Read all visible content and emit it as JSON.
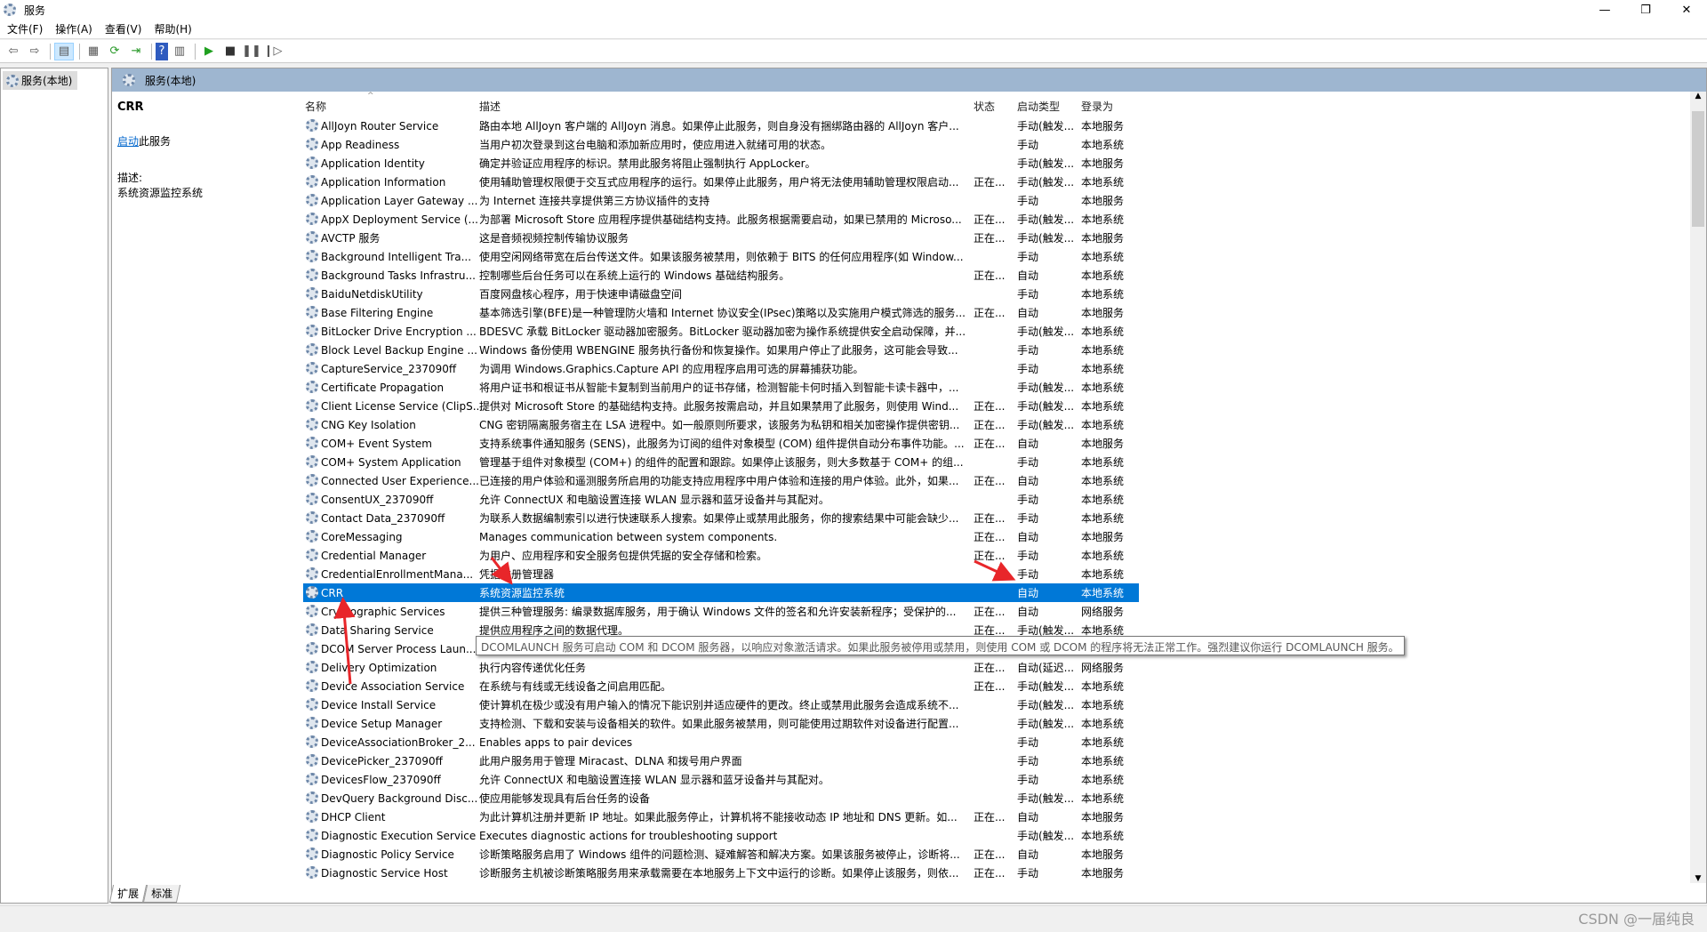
{
  "window": {
    "title": "服务",
    "minimize": "—",
    "restore": "❐",
    "close": "✕"
  },
  "menu": [
    "文件(F)",
    "操作(A)",
    "查看(V)",
    "帮助(H)"
  ],
  "toolbar": [
    "back-icon",
    "forward-icon",
    "show-hide-console-tree-icon",
    "properties-icon",
    "refresh-icon",
    "export-list-icon",
    "help-icon",
    "show-action-pane-icon",
    "start-service-icon",
    "stop-service-icon",
    "pause-service-icon",
    "resume-service-icon"
  ],
  "tree": {
    "root": "服务(本地)"
  },
  "main": {
    "header": "服务(本地)"
  },
  "extended": {
    "service_name": "CRR",
    "start_link": "启动",
    "start_suffix": "此服务",
    "desc_label": "描述:",
    "desc": "系统资源监控系统"
  },
  "columns": [
    "名称",
    "描述",
    "状态",
    "启动类型",
    "登录为"
  ],
  "selected_index": 25,
  "rows": [
    [
      "AllJoyn Router Service",
      "路由本地 AllJoyn 客户端的 AllJoyn 消息。如果停止此服务，则自身没有捆绑路由器的 AllJoyn 客户...",
      "",
      "手动(触发...",
      "本地服务"
    ],
    [
      "App Readiness",
      "当用户初次登录到这台电脑和添加新应用时，使应用进入就绪可用的状态。",
      "",
      "手动",
      "本地系统"
    ],
    [
      "Application Identity",
      "确定并验证应用程序的标识。禁用此服务将阻止强制执行 AppLocker。",
      "",
      "手动(触发...",
      "本地服务"
    ],
    [
      "Application Information",
      "使用辅助管理权限便于交互式应用程序的运行。如果停止此服务，用户将无法使用辅助管理权限启动...",
      "正在...",
      "手动(触发...",
      "本地系统"
    ],
    [
      "Application Layer Gateway ...",
      "为 Internet 连接共享提供第三方协议插件的支持",
      "",
      "手动",
      "本地服务"
    ],
    [
      "AppX Deployment Service (...",
      "为部署 Microsoft Store 应用程序提供基础结构支持。此服务根据需要启动，如果已禁用的 Microso...",
      "正在...",
      "手动(触发...",
      "本地系统"
    ],
    [
      "AVCTP 服务",
      "这是音频视频控制传输协议服务",
      "正在...",
      "手动(触发...",
      "本地服务"
    ],
    [
      "Background Intelligent Tra...",
      "使用空闲网络带宽在后台传送文件。如果该服务被禁用，则依赖于 BITS 的任何应用程序(如 Window...",
      "",
      "手动",
      "本地系统"
    ],
    [
      "Background Tasks Infrastru...",
      "控制哪些后台任务可以在系统上运行的 Windows 基础结构服务。",
      "正在...",
      "自动",
      "本地系统"
    ],
    [
      "BaiduNetdiskUtility",
      "百度网盘核心程序，用于快速申请磁盘空间",
      "",
      "手动",
      "本地系统"
    ],
    [
      "Base Filtering Engine",
      "基本筛选引擎(BFE)是一种管理防火墙和 Internet 协议安全(IPsec)策略以及实施用户模式筛选的服务...",
      "正在...",
      "自动",
      "本地服务"
    ],
    [
      "BitLocker Drive Encryption ...",
      "BDESVC 承载 BitLocker 驱动器加密服务。BitLocker 驱动器加密为操作系统提供安全启动保障，并...",
      "",
      "手动(触发...",
      "本地系统"
    ],
    [
      "Block Level Backup Engine ...",
      "Windows 备份使用 WBENGINE 服务执行备份和恢复操作。如果用户停止了此服务，这可能会导致...",
      "",
      "手动",
      "本地系统"
    ],
    [
      "CaptureService_237090ff",
      "为调用 Windows.Graphics.Capture API 的应用程序启用可选的屏幕捕获功能。",
      "",
      "手动",
      "本地系统"
    ],
    [
      "Certificate Propagation",
      "将用户证书和根证书从智能卡复制到当前用户的证书存储，检测智能卡何时插入到智能卡读卡器中，...",
      "",
      "手动(触发...",
      "本地系统"
    ],
    [
      "Client License Service (ClipS...",
      "提供对 Microsoft Store 的基础结构支持。此服务按需启动，并且如果禁用了此服务，则使用 Wind...",
      "正在...",
      "手动(触发...",
      "本地系统"
    ],
    [
      "CNG Key Isolation",
      "CNG 密钥隔离服务宿主在 LSA 进程中。如一般原则所要求，该服务为私钥和相关加密操作提供密钥...",
      "正在...",
      "手动(触发...",
      "本地系统"
    ],
    [
      "COM+ Event System",
      "支持系统事件通知服务 (SENS)，此服务为订阅的组件对象模型 (COM) 组件提供自动分布事件功能。...",
      "正在...",
      "自动",
      "本地服务"
    ],
    [
      "COM+ System Application",
      "管理基于组件对象模型 (COM+) 的组件的配置和跟踪。如果停止该服务，则大多数基于 COM+ 的组...",
      "",
      "手动",
      "本地系统"
    ],
    [
      "Connected User Experience...",
      "已连接的用户体验和遥测服务所启用的功能支持应用程序中用户体验和连接的用户体验。此外，如果...",
      "正在...",
      "自动",
      "本地系统"
    ],
    [
      "ConsentUX_237090ff",
      "允许 ConnectUX 和电脑设置连接 WLAN 显示器和蓝牙设备并与其配对。",
      "",
      "手动",
      "本地系统"
    ],
    [
      "Contact Data_237090ff",
      "为联系人数据编制索引以进行快速联系人搜索。如果停止或禁用此服务，你的搜索结果中可能会缺少...",
      "正在...",
      "手动",
      "本地系统"
    ],
    [
      "CoreMessaging",
      "Manages communication between system components.",
      "正在...",
      "自动",
      "本地服务"
    ],
    [
      "Credential Manager",
      "为用户、应用程序和安全服务包提供凭据的安全存储和检索。",
      "正在...",
      "手动",
      "本地系统"
    ],
    [
      "CredentialEnrollmentMana...",
      "凭据注册管理器",
      "",
      "手动",
      "本地系统"
    ],
    [
      "CRR",
      "系统资源监控系统",
      "",
      "自动",
      "本地系统"
    ],
    [
      "Cryptographic Services",
      "提供三种管理服务: 编录数据库服务，用于确认 Windows 文件的签名和允许安装新程序；受保护的...",
      "正在...",
      "自动",
      "网络服务"
    ],
    [
      "Data Sharing Service",
      "提供应用程序之间的数据代理。",
      "正在...",
      "手动(触发...",
      "本地系统"
    ],
    [
      "DCOM Server Process Laun...",
      "",
      "",
      "",
      ""
    ],
    [
      "Delivery Optimization",
      "执行内容传递优化任务",
      "正在...",
      "自动(延迟...",
      "网络服务"
    ],
    [
      "Device Association Service",
      "在系统与有线或无线设备之间启用匹配。",
      "正在...",
      "手动(触发...",
      "本地系统"
    ],
    [
      "Device Install Service",
      "使计算机在极少或没有用户输入的情况下能识别并适应硬件的更改。终止或禁用此服务会造成系统不...",
      "",
      "手动(触发...",
      "本地系统"
    ],
    [
      "Device Setup Manager",
      "支持检测、下载和安装与设备相关的软件。如果此服务被禁用，则可能使用过期软件对设备进行配置...",
      "",
      "手动(触发...",
      "本地系统"
    ],
    [
      "DeviceAssociationBroker_2...",
      "Enables apps to pair devices",
      "",
      "手动",
      "本地系统"
    ],
    [
      "DevicePicker_237090ff",
      "此用户服务用于管理 Miracast、DLNA 和拨号用户界面",
      "",
      "手动",
      "本地系统"
    ],
    [
      "DevicesFlow_237090ff",
      "允许 ConnectUX 和电脑设置连接 WLAN 显示器和蓝牙设备并与其配对。",
      "",
      "手动",
      "本地系统"
    ],
    [
      "DevQuery Background Disc...",
      "使应用能够发现具有后台任务的设备",
      "",
      "手动(触发...",
      "本地系统"
    ],
    [
      "DHCP Client",
      "为此计算机注册并更新 IP 地址。如果此服务停止，计算机将不能接收动态 IP 地址和 DNS 更新。如...",
      "正在...",
      "自动",
      "本地服务"
    ],
    [
      "Diagnostic Execution Service",
      "Executes diagnostic actions for troubleshooting support",
      "",
      "手动(触发...",
      "本地系统"
    ],
    [
      "Diagnostic Policy Service",
      "诊断策略服务启用了 Windows 组件的问题检测、疑难解答和解决方案。如果该服务被停止，诊断将...",
      "正在...",
      "自动",
      "本地服务"
    ],
    [
      "Diagnostic Service Host",
      "诊断服务主机被诊断策略服务用来承载需要在本地服务上下文中运行的诊断。如果停止该服务，则依...",
      "正在...",
      "手动",
      "本地服务"
    ]
  ],
  "tooltip": "DCOMLAUNCH 服务可启动 COM 和 DCOM 服务器，以响应对象激活请求。如果此服务被停用或禁用，则使用 COM 或 DCOM 的程序将无法正常工作。强烈建议你运行 DCOMLAUNCH 服务。",
  "tabs": [
    "扩展",
    "标准"
  ],
  "watermark": "CSDN @一届纯良",
  "colors": {
    "selection": "#0078d7",
    "header_band": "#9eb6d0",
    "annotation_arrow": "#e8262a",
    "link": "#0066cc"
  }
}
